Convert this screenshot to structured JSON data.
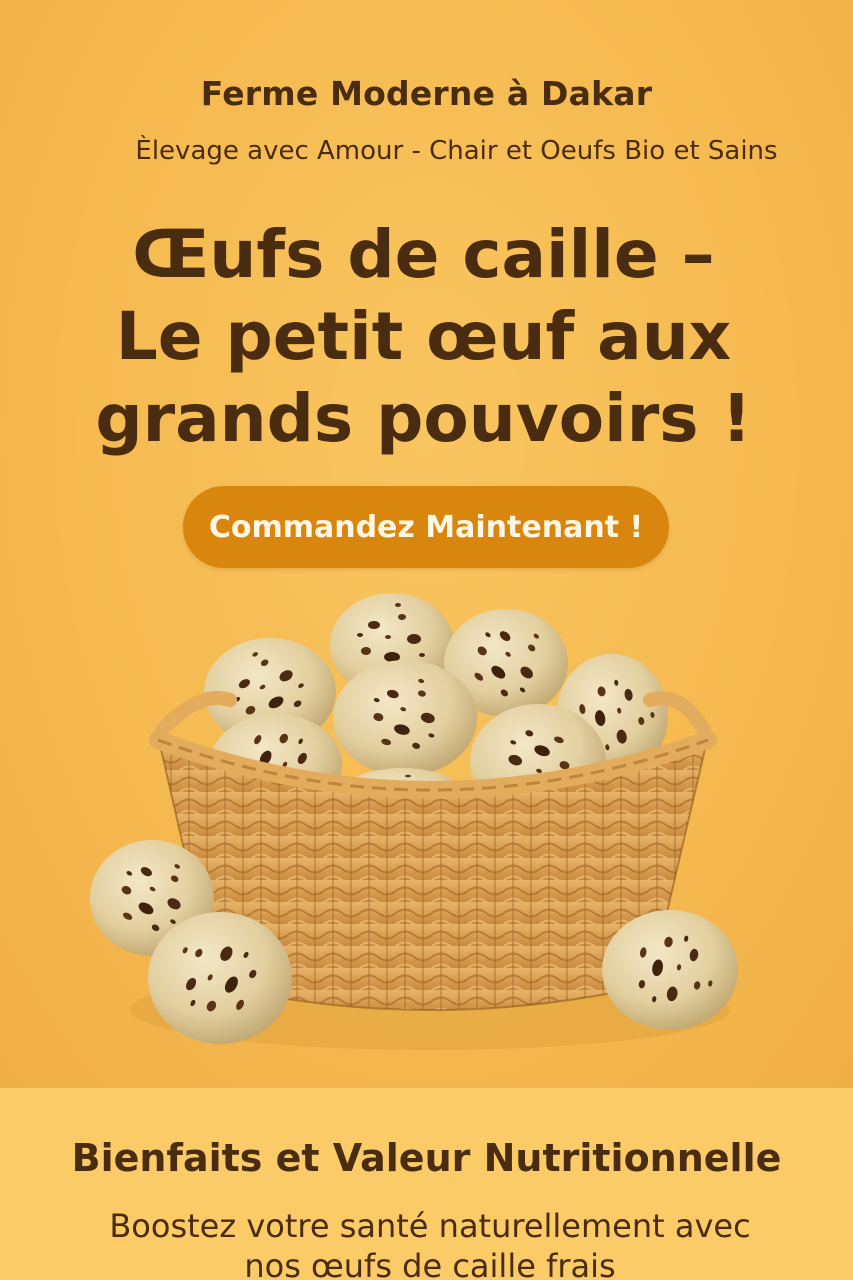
{
  "header": {
    "farm_name": "Ferme Moderne à Dakar",
    "tagline": "Èlevage avec Amour - Chair et Oeufs Bio et Sains"
  },
  "hero": {
    "headline_lines": [
      "Œufs de caille –",
      "Le petit œuf aux",
      "grands pouvoirs !"
    ],
    "cta_label": "Commandez Maintenant !"
  },
  "benefits": {
    "title": "Bienfaits et Valeur Nutritionnelle",
    "text": "Boostez votre santé naturellement avec nos œufs de caille frais"
  },
  "colors": {
    "background": "#f6be55",
    "text": "#4a2c10",
    "cta": "#d9860f",
    "cta_text": "#fff6e6",
    "benefits_bg": "#fbcb68"
  },
  "icons": {
    "hero_image": "quail-eggs-basket-image"
  }
}
